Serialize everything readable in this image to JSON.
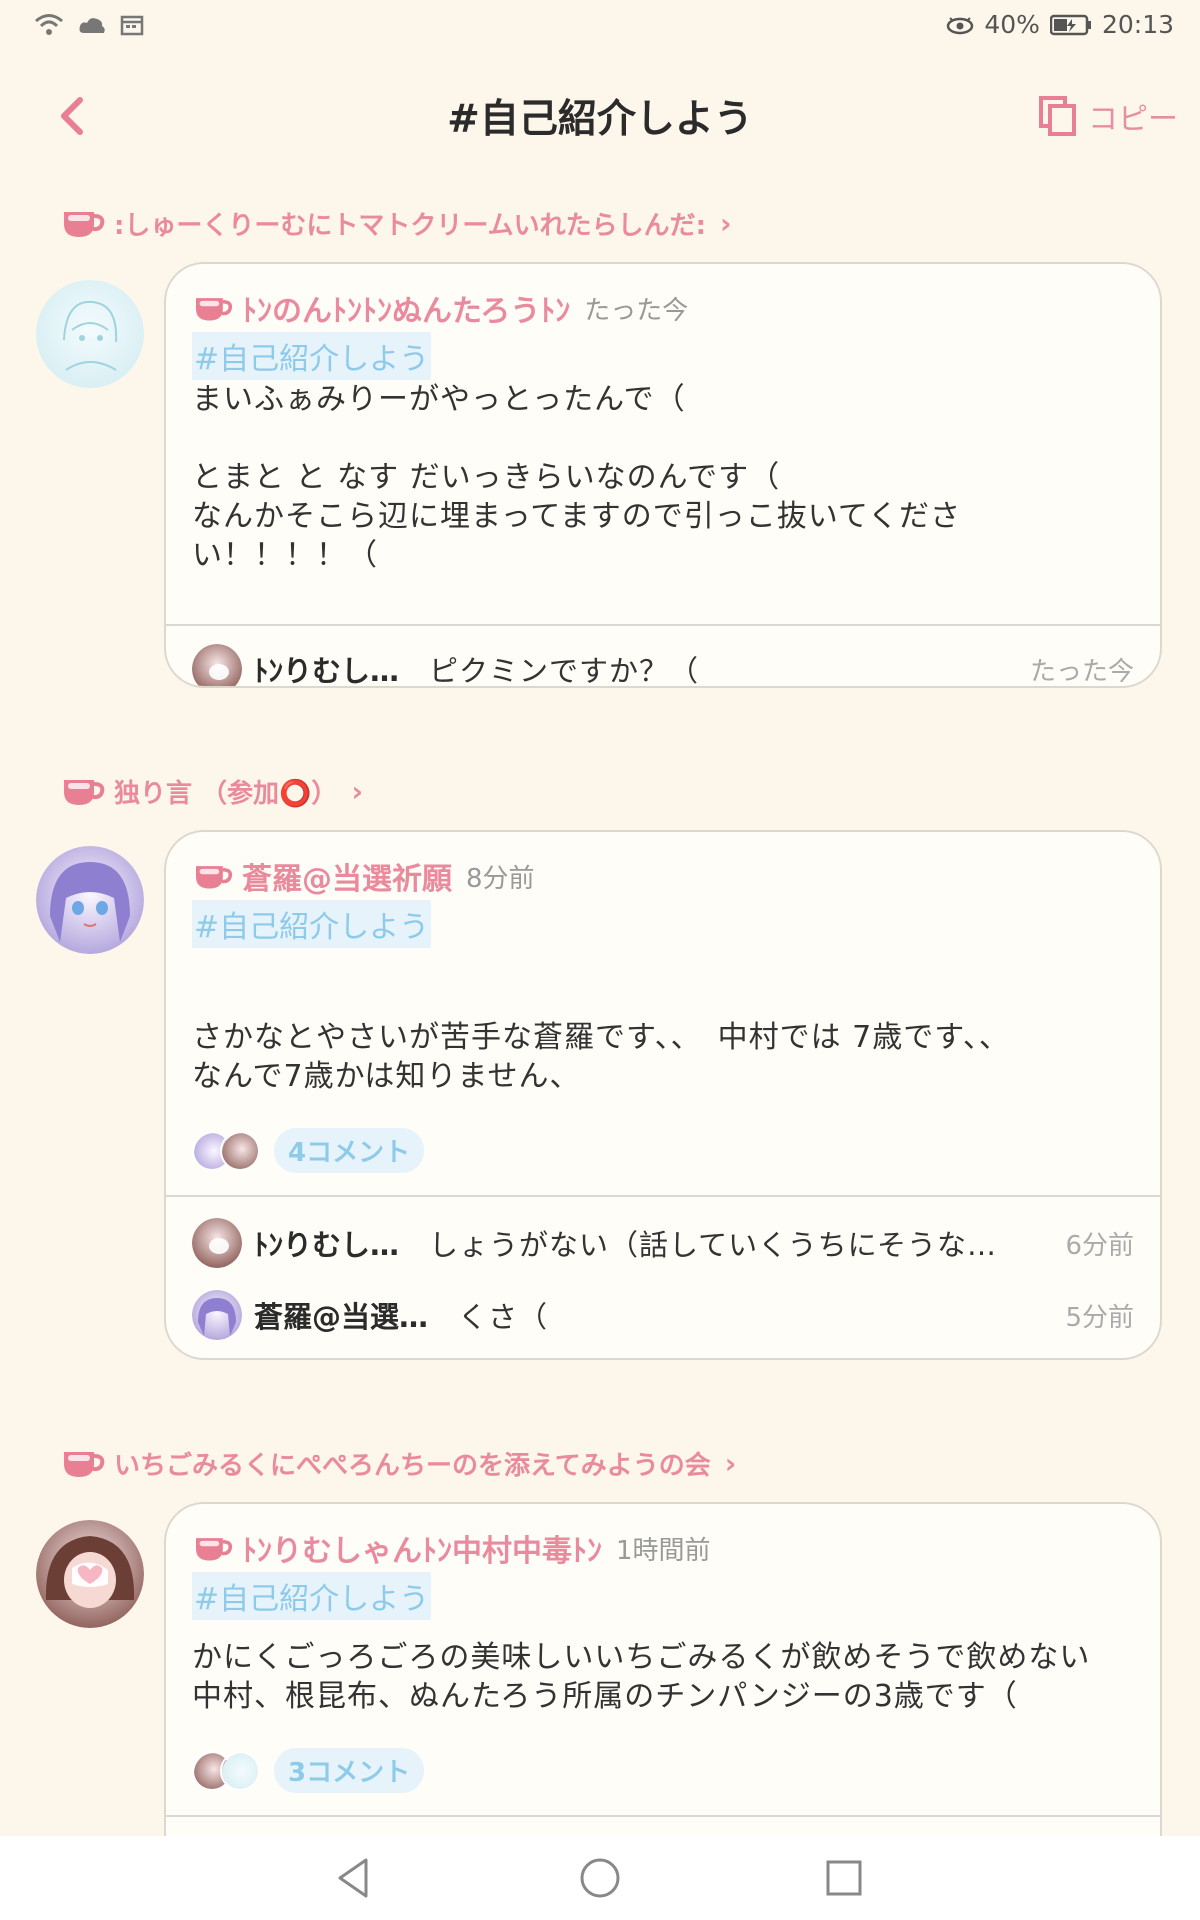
{
  "status": {
    "battery": "40%",
    "time": "20:13"
  },
  "header": {
    "title": "#自己紹介しよう",
    "copy_label": "コピー"
  },
  "sections": [
    {
      "label": ":しゅーくりーむにトマトクリームいれたらしんだ:",
      "post": {
        "author": "ﾄﾝのんﾄﾝﾄﾝぬんたろうﾄﾝ",
        "time": "たった今",
        "tag": "#自己紹介しよう",
        "text": "まいふぁみりーがやっとったんで（\n\nとまと と なす だいっきらいなのんです（\nなんかそこら辺に埋まってますので引っこ抜いてくださ\nい！！！！（"
      },
      "replies": [
        {
          "name": "ﾄﾝりむし…",
          "text": "ピクミンですか？（",
          "time": "たった今"
        }
      ]
    },
    {
      "label": "独り言 （参加⭕）",
      "post": {
        "author": "蒼羅@当選祈願",
        "time": "8分前",
        "tag": "#自己紹介しよう",
        "text": "さかなとやさいが苦手な蒼羅です、、　中村では 7歳です、、\nなんで7歳かは知りません、",
        "comments": "4コメント"
      },
      "replies": [
        {
          "name": "ﾄﾝりむし…",
          "text": "しょうがない（話していくうちにそうな…",
          "time": "6分前"
        },
        {
          "name": "蒼羅@当選…",
          "text": "くさ（",
          "time": "5分前"
        }
      ]
    },
    {
      "label": "いちごみるくにぺぺろんちーのを添えてみようの会",
      "post": {
        "author": "ﾄﾝりむしゃんﾄﾝ中村中毒ﾄﾝ",
        "time": "1時間前",
        "tag": "#自己紹介しよう",
        "text": "かにくごっろごろの美味しいいちごみるくが飲めそうで飲めない\n中村、根昆布、ぬんたろう所属のチンパンジーの3歳です（",
        "comments": "3コメント"
      }
    }
  ]
}
